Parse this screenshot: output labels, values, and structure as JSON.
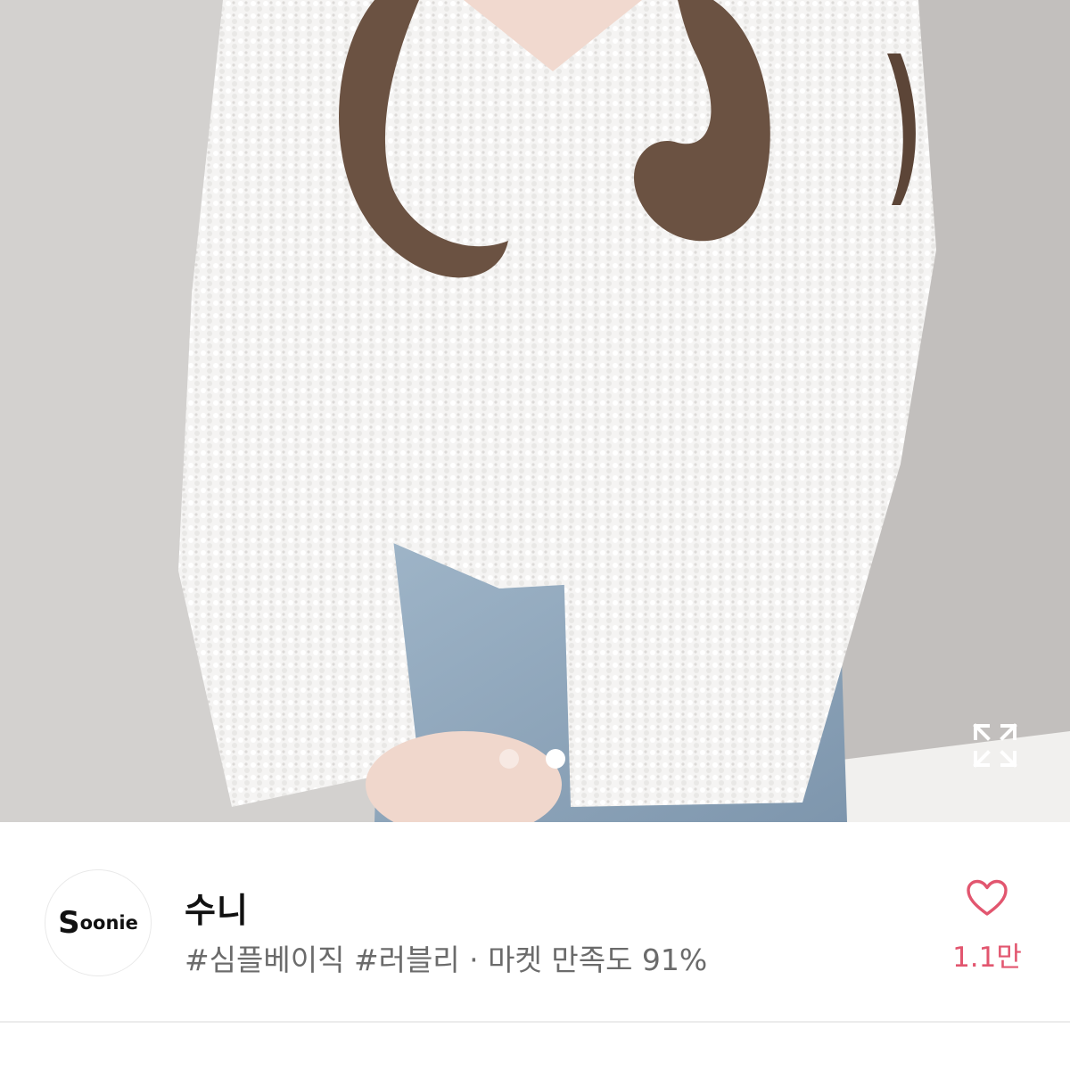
{
  "product_image": {
    "alt": "white fluffy knit cardigan",
    "current_index": 2,
    "total_images": 2
  },
  "icons": {
    "expand": "expand-icon",
    "like": "heart-outline-icon"
  },
  "seller": {
    "logo_initial": "S",
    "logo_rest": "oonie",
    "name": "수니",
    "tags_line": "#심플베이직 #러블리 · 마켓 만족도 91%"
  },
  "like": {
    "count": "1.1만"
  },
  "colors": {
    "accent": "#e2566f",
    "text_primary": "#111111",
    "text_secondary": "#6b6b6b"
  }
}
